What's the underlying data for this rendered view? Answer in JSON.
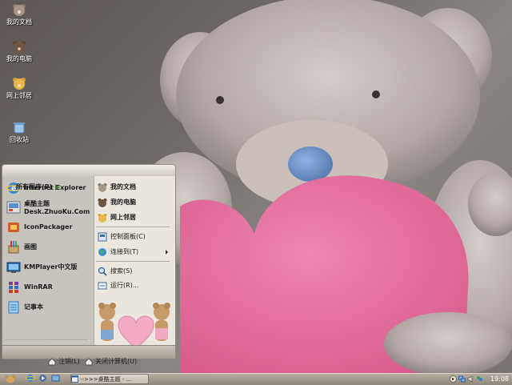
{
  "desktop": {
    "icons": [
      {
        "label": "我的文档",
        "icon": "bear-documents-icon"
      },
      {
        "label": "我的电脑",
        "icon": "bear-computer-icon"
      },
      {
        "label": "网上邻居",
        "icon": "bear-network-icon"
      },
      {
        "label": "回收站",
        "icon": "recycle-bin-icon"
      }
    ]
  },
  "start_menu": {
    "left_items": [
      {
        "label": "Internet Explorer",
        "icon": "ie-icon"
      },
      {
        "label": "桌酷主题",
        "label2": "Desk.ZhuoKu.Com",
        "icon": "zhuoku-icon"
      },
      {
        "label": "IconPackager",
        "icon": "iconpackager-icon"
      },
      {
        "label": "画图",
        "icon": "paint-icon"
      },
      {
        "label": "KMPlayer中文版",
        "icon": "kmplayer-icon"
      },
      {
        "label": "WinRAR",
        "icon": "winrar-icon"
      },
      {
        "label": "记事本",
        "icon": "notepad-icon"
      }
    ],
    "all_programs": "所有程序(P)",
    "right_items": [
      {
        "label": "我的文档",
        "icon": "bear-documents-icon"
      },
      {
        "label": "我的电脑",
        "icon": "bear-computer-icon"
      },
      {
        "label": "网上邻居",
        "icon": "bear-network-icon"
      },
      {
        "label": "控制面板(C)",
        "icon": "control-panel-icon"
      },
      {
        "label": "连接到(T)",
        "icon": "connect-globe-icon"
      },
      {
        "label": "搜索(S)",
        "icon": "search-icon"
      },
      {
        "label": "运行(R)...",
        "icon": "run-icon"
      }
    ],
    "footer": {
      "logoff": "注销(L)",
      "shutdown": "关闭计算机(U)"
    }
  },
  "taskbar": {
    "task_label": "-->>>桌酷主题 - ...",
    "clock": "19:08"
  },
  "colors": {
    "heart": "#e46b9a",
    "bear_fur": "#b9aeab",
    "bear_nose": "#6f93c8",
    "taskbar": "#a79f94"
  }
}
